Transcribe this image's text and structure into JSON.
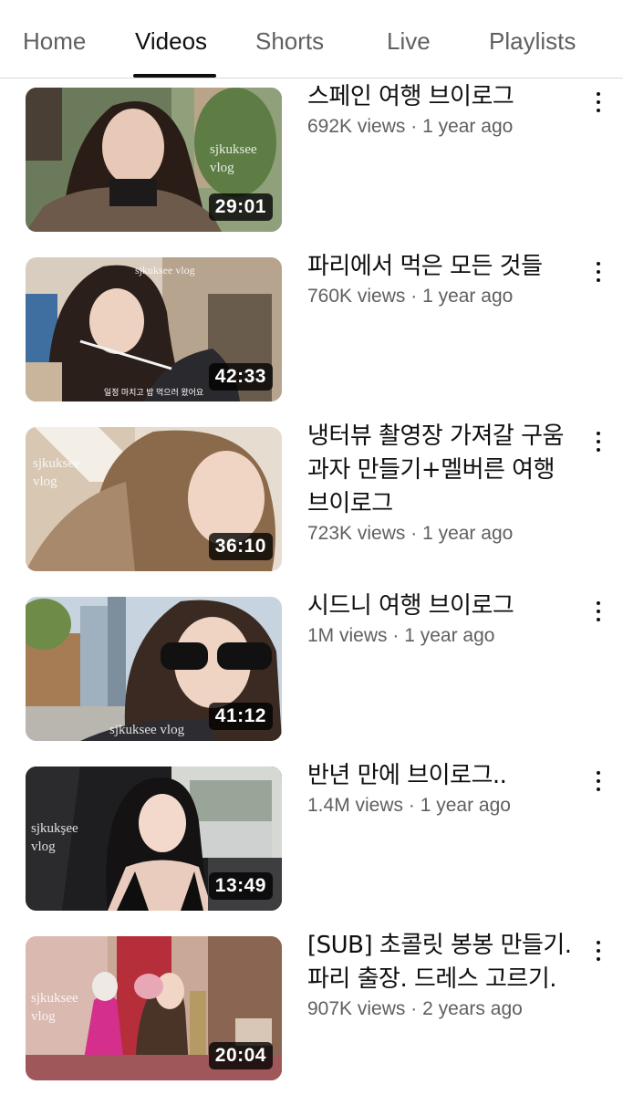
{
  "tabs": [
    {
      "label": "Home",
      "active": false
    },
    {
      "label": "Videos",
      "active": true
    },
    {
      "label": "Shorts",
      "active": false
    },
    {
      "label": "Live",
      "active": false
    },
    {
      "label": "Playlists",
      "active": false
    }
  ],
  "videos": [
    {
      "title": "스페인 여행 브이로그",
      "views": "692K views",
      "age": "1 year ago",
      "duration": "29:01",
      "watermark": "sjkuksee\nvlog"
    },
    {
      "title": "파리에서 먹은 모든 것들",
      "views": "760K views",
      "age": "1 year ago",
      "duration": "42:33",
      "watermark": "sjkuksee vlog",
      "caption": "일정 마치고 밥 먹으러 왔어요"
    },
    {
      "title": "냉터뷰 촬영장 가져갈 구움과자 만들기+멜버른 여행 브이로그",
      "views": "723K views",
      "age": "1 year ago",
      "duration": "36:10",
      "watermark": "sjkuksee\nvlog"
    },
    {
      "title": "시드니 여행 브이로그",
      "views": "1M views",
      "age": "1 year ago",
      "duration": "41:12",
      "watermark": "sjkuksee vlog"
    },
    {
      "title": "반년 만에 브이로그..",
      "views": "1.4M views",
      "age": "1 year ago",
      "duration": "13:49",
      "watermark": "sjkukşee\nvlog"
    },
    {
      "title": "[SUB] 초콜릿 봉봉 만들기. 파리 출장. 드레스 고르기.",
      "views": "907K views",
      "age": "2 years ago",
      "duration": "20:04",
      "watermark": "sjkuksee\nvlog"
    }
  ],
  "separator": " · ",
  "icons": {
    "more": "more-vert-icon"
  }
}
